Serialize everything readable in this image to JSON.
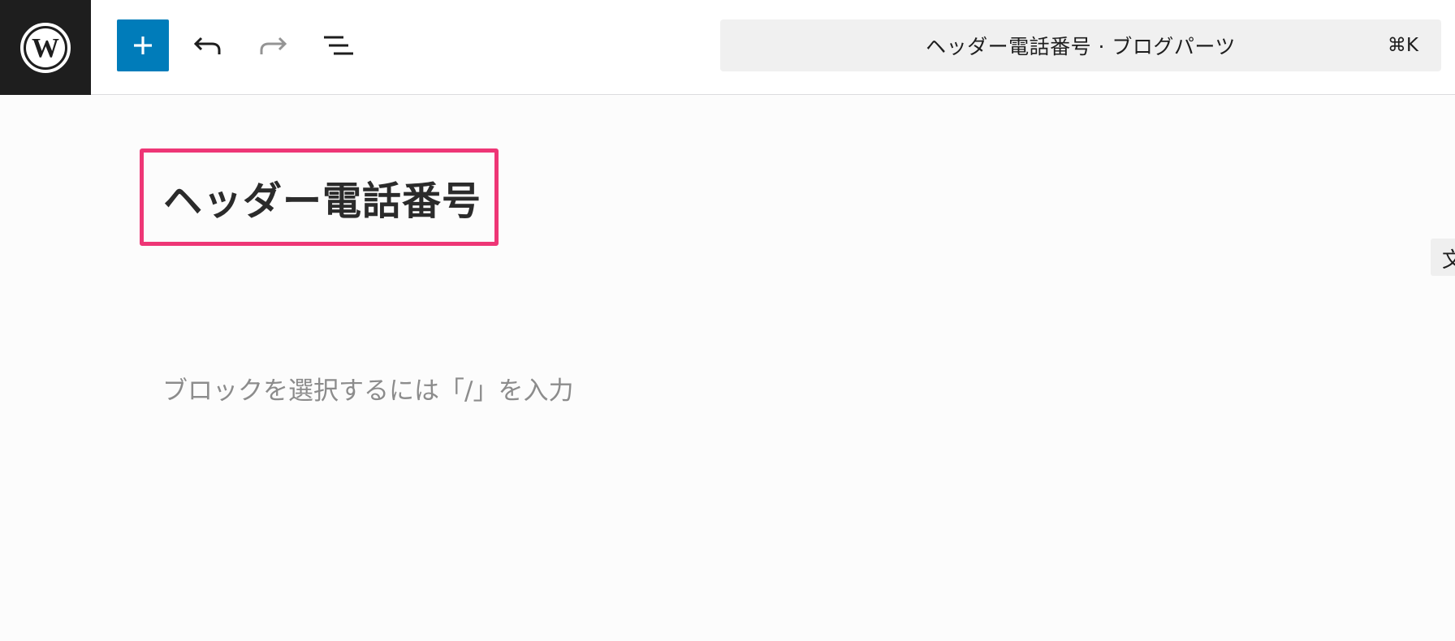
{
  "toolbar": {
    "logo_icon": "wordpress-logo-icon",
    "add_icon": "plus-icon",
    "undo_icon": "undo-arrow-icon",
    "redo_icon": "redo-arrow-icon",
    "list_view_icon": "list-view-icon",
    "command_bar": {
      "title": "ヘッダー電話番号 · ブログパーツ",
      "shortcut": "⌘K"
    }
  },
  "editor": {
    "heading": "ヘッダー電話番号",
    "placeholder": "ブロックを選択するには「/」を入力",
    "side_tab_label": "文"
  },
  "colors": {
    "accent": "#007cba",
    "highlight_border": "#ee3676",
    "logo_bg": "#1e1e1e",
    "command_bar_bg": "#f0f0f0"
  }
}
